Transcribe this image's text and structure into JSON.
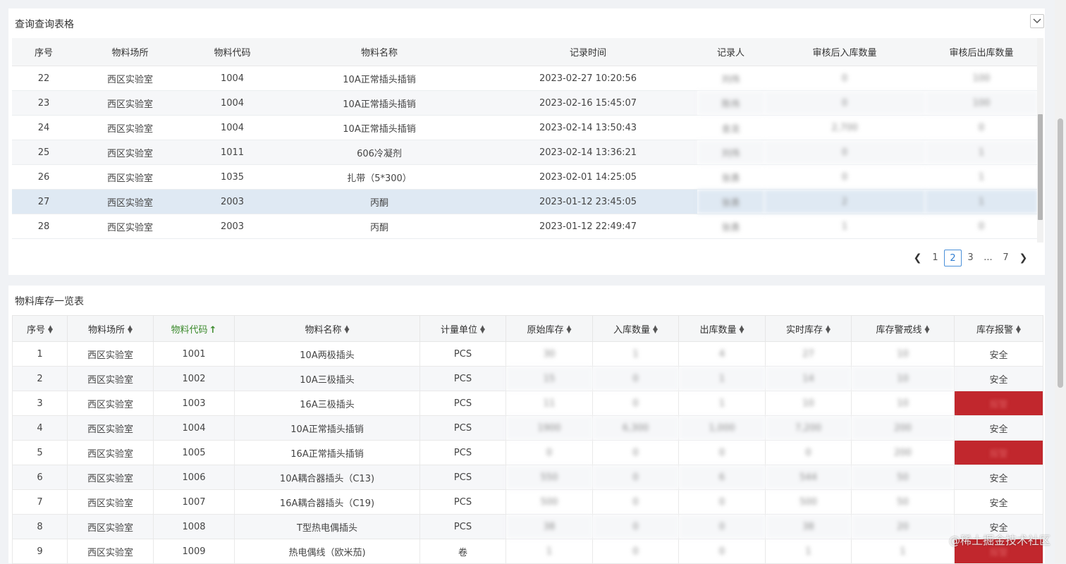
{
  "query_table": {
    "title": "查询查询表格",
    "columns": [
      "序号",
      "物料场所",
      "物料代码",
      "物料名称",
      "记录时间",
      "记录人",
      "审核后入库数量",
      "审核后出库数量"
    ],
    "rows": [
      {
        "seq": "22",
        "place": "西区实验室",
        "code": "1004",
        "name": "10A正常插头插销",
        "time": "2023-02-27 10:20:56",
        "recorder": "刘伟",
        "in_qty": "0",
        "out_qty": "100"
      },
      {
        "seq": "23",
        "place": "西区实验室",
        "code": "1004",
        "name": "10A正常插头插销",
        "time": "2023-02-16 15:45:07",
        "recorder": "陈伟",
        "in_qty": "0",
        "out_qty": "100"
      },
      {
        "seq": "24",
        "place": "西区实验室",
        "code": "1004",
        "name": "10A正常插头插销",
        "time": "2023-02-14 13:50:43",
        "recorder": "金龙",
        "in_qty": "2,700",
        "out_qty": "0"
      },
      {
        "seq": "25",
        "place": "西区实验室",
        "code": "1011",
        "name": "606冷凝剂",
        "time": "2023-02-14 13:36:21",
        "recorder": "刘伟",
        "in_qty": "0",
        "out_qty": "1"
      },
      {
        "seq": "26",
        "place": "西区实验室",
        "code": "1035",
        "name": "扎带（5*300）",
        "time": "2023-02-01 14:25:05",
        "recorder": "张勇",
        "in_qty": "0",
        "out_qty": "1"
      },
      {
        "seq": "27",
        "place": "西区实验室",
        "code": "2003",
        "name": "丙酮",
        "time": "2023-01-12 23:45:05",
        "recorder": "张勇",
        "in_qty": "2",
        "out_qty": "1"
      },
      {
        "seq": "28",
        "place": "西区实验室",
        "code": "2003",
        "name": "丙酮",
        "time": "2023-01-12 22:49:47",
        "recorder": "张勇",
        "in_qty": "1",
        "out_qty": "0"
      }
    ],
    "pagination": {
      "pages": [
        "1",
        "2",
        "3",
        "...",
        "7"
      ],
      "current": "2"
    }
  },
  "inventory_table": {
    "title": "物料库存一览表",
    "columns": [
      "序号",
      "物料场所",
      "物料代码",
      "物料名称",
      "计量单位",
      "原始库存",
      "入库数量",
      "出库数量",
      "实时库存",
      "库存警戒线",
      "库存报警"
    ],
    "sorted_column": "物料代码",
    "rows": [
      {
        "seq": "1",
        "place": "西区实验室",
        "code": "1001",
        "name": "10A两极插头",
        "unit": "PCS",
        "orig": "30",
        "in": "1",
        "out": "4",
        "real": "27",
        "warn": "10",
        "alarm": "安全",
        "alarm_state": "safe"
      },
      {
        "seq": "2",
        "place": "西区实验室",
        "code": "1002",
        "name": "10A三极插头",
        "unit": "PCS",
        "orig": "15",
        "in": "0",
        "out": "1",
        "real": "14",
        "warn": "10",
        "alarm": "安全",
        "alarm_state": "safe"
      },
      {
        "seq": "3",
        "place": "西区实验室",
        "code": "1003",
        "name": "16A三极插头",
        "unit": "PCS",
        "orig": "11",
        "in": "0",
        "out": "1",
        "real": "10",
        "warn": "10",
        "alarm": "报警",
        "alarm_state": "alarm"
      },
      {
        "seq": "4",
        "place": "西区实验室",
        "code": "1004",
        "name": "10A正常插头插销",
        "unit": "PCS",
        "orig": "1900",
        "in": "6,300",
        "out": "1,000",
        "real": "7,200",
        "warn": "200",
        "alarm": "安全",
        "alarm_state": "safe"
      },
      {
        "seq": "5",
        "place": "西区实验室",
        "code": "1005",
        "name": "16A正常插头插销",
        "unit": "PCS",
        "orig": "0",
        "in": "0",
        "out": "0",
        "real": "0",
        "warn": "200",
        "alarm": "报警",
        "alarm_state": "alarm"
      },
      {
        "seq": "6",
        "place": "西区实验室",
        "code": "1006",
        "name": "10A耦合器插头（C13)",
        "unit": "PCS",
        "orig": "550",
        "in": "0",
        "out": "6",
        "real": "544",
        "warn": "50",
        "alarm": "安全",
        "alarm_state": "safe"
      },
      {
        "seq": "7",
        "place": "西区实验室",
        "code": "1007",
        "name": "16A耦合器插头（C19)",
        "unit": "PCS",
        "orig": "500",
        "in": "0",
        "out": "0",
        "real": "500",
        "warn": "50",
        "alarm": "安全",
        "alarm_state": "safe"
      },
      {
        "seq": "8",
        "place": "西区实验室",
        "code": "1008",
        "name": "T型热电偶插头",
        "unit": "PCS",
        "orig": "38",
        "in": "0",
        "out": "0",
        "real": "38",
        "warn": "20",
        "alarm": "安全",
        "alarm_state": "safe"
      },
      {
        "seq": "9",
        "place": "西区实验室",
        "code": "1009",
        "name": "热电偶线（欧米茄)",
        "unit": "卷",
        "orig": "1",
        "in": "0",
        "out": "0",
        "real": "1",
        "warn": "1",
        "alarm": "报警",
        "alarm_state": "alarm"
      }
    ]
  },
  "watermark": "@稀土掘金技术社区",
  "colors": {
    "alarm": "#c1272d",
    "sorted": "#3b8a2c",
    "active_page": "#2f7dd1",
    "selected_row": "#dfe9f3"
  }
}
